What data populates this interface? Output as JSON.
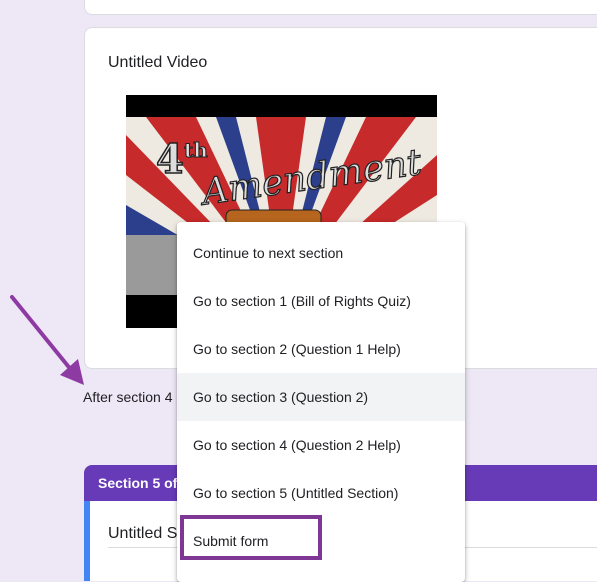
{
  "video_card": {
    "title": "Untitled Video",
    "thumbnail_text": "4th Amendment"
  },
  "after_section": {
    "label": "After section 4"
  },
  "section": {
    "header": "Section 5 of",
    "title": "Untitled S"
  },
  "menu": {
    "items": [
      {
        "label": "Continue to next section"
      },
      {
        "label": "Go to section 1 (Bill of Rights Quiz)"
      },
      {
        "label": "Go to section 2 (Question 1 Help)"
      },
      {
        "label": "Go to section 3 (Question 2)"
      },
      {
        "label": "Go to section 4 (Question 2 Help)"
      },
      {
        "label": "Go to section 5 (Untitled Section)"
      },
      {
        "label": "Submit form"
      }
    ],
    "hovered_index": 3,
    "highlighted_index": 6
  },
  "colors": {
    "background": "#ede7f6",
    "section_header": "#673ab7",
    "accent_border": "#4285f4",
    "annotation": "#7e3794"
  }
}
